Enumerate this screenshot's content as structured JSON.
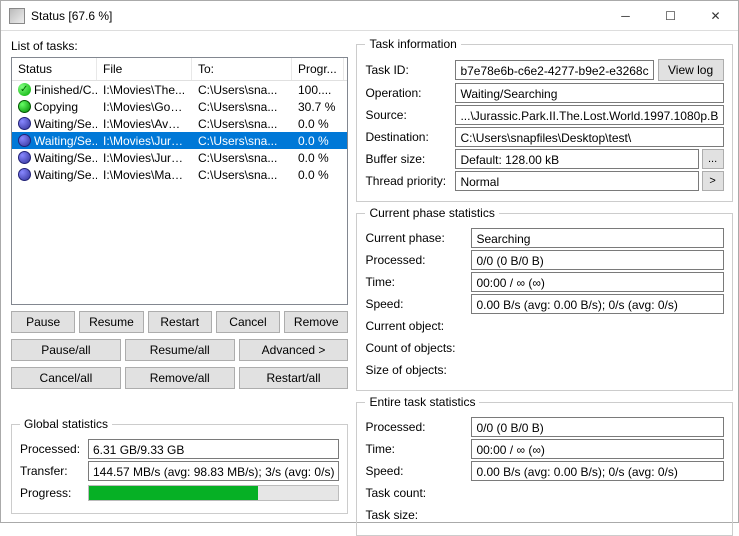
{
  "window": {
    "title": "Status [67.6 %]"
  },
  "left": {
    "listLabel": "List of tasks:",
    "columns": {
      "status": "Status",
      "file": "File",
      "to": "To:",
      "prog": "Progr..."
    },
    "rows": [
      {
        "icon": "fin",
        "status": "Finished/C...",
        "file": "I:\\Movies\\The...",
        "to": "C:\\Users\\sna...",
        "prog": "100...."
      },
      {
        "icon": "copy",
        "status": "Copying",
        "file": "I:\\Movies\\Goos...",
        "to": "C:\\Users\\sna...",
        "prog": "30.7 %"
      },
      {
        "icon": "wait",
        "status": "Waiting/Se...",
        "file": "I:\\Movies\\Aven...",
        "to": "C:\\Users\\sna...",
        "prog": "0.0 %"
      },
      {
        "icon": "wait",
        "status": "Waiting/Se...",
        "file": "I:\\Movies\\Juras...",
        "to": "C:\\Users\\sna...",
        "prog": "0.0 %",
        "sel": true
      },
      {
        "icon": "wait",
        "status": "Waiting/Se...",
        "file": "I:\\Movies\\Juras...",
        "to": "C:\\Users\\sna...",
        "prog": "0.0 %"
      },
      {
        "icon": "wait",
        "status": "Waiting/Se...",
        "file": "I:\\Movies\\Mad ...",
        "to": "C:\\Users\\sna...",
        "prog": "0.0 %"
      }
    ],
    "buttons": {
      "pause": "Pause",
      "resume": "Resume",
      "restart": "Restart",
      "cancel": "Cancel",
      "remove": "Remove",
      "pauseAll": "Pause/all",
      "resumeAll": "Resume/all",
      "advanced": "Advanced >",
      "cancelAll": "Cancel/all",
      "removeAll": "Remove/all",
      "restartAll": "Restart/all"
    },
    "global": {
      "legend": "Global statistics",
      "processedLabel": "Processed:",
      "processed": "6.31 GB/9.33 GB",
      "transferLabel": "Transfer:",
      "transfer": "144.57 MB/s (avg: 98.83 MB/s); 3/s (avg: 0/s)",
      "progressLabel": "Progress:",
      "progressPct": 67.6
    }
  },
  "task": {
    "legend": "Task information",
    "idLabel": "Task ID:",
    "id": "b7e78e6b-c6e2-4277-b9e2-e3268c",
    "viewLog": "View log",
    "opLabel": "Operation:",
    "op": "Waiting/Searching",
    "srcLabel": "Source:",
    "src": "...\\Jurassic.Park.II.The.Lost.World.1997.1080p.B",
    "dstLabel": "Destination:",
    "dst": "C:\\Users\\snapfiles\\Desktop\\test\\",
    "bufLabel": "Buffer size:",
    "buf": "Default: 128.00 kB",
    "prioLabel": "Thread priority:",
    "prio": "Normal"
  },
  "phase": {
    "legend": "Current phase statistics",
    "phaseLabel": "Current phase:",
    "phase": "Searching",
    "procLabel": "Processed:",
    "proc": "0/0 (0 B/0 B)",
    "timeLabel": "Time:",
    "time": "00:00 / ∞ (∞)",
    "speedLabel": "Speed:",
    "speed": "0.00 B/s (avg: 0.00 B/s); 0/s (avg: 0/s)",
    "curObjLabel": "Current object:",
    "curObj": "",
    "countLabel": "Count of objects:",
    "count": "",
    "sizeLabel": "Size of objects:",
    "size": ""
  },
  "entire": {
    "legend": "Entire task statistics",
    "procLabel": "Processed:",
    "proc": "0/0 (0 B/0 B)",
    "timeLabel": "Time:",
    "time": "00:00 / ∞ (∞)",
    "speedLabel": "Speed:",
    "speed": "0.00 B/s (avg: 0.00 B/s); 0/s (avg: 0/s)",
    "tcountLabel": "Task count:",
    "tcount": "",
    "tsizeLabel": "Task size:",
    "tsize": ""
  }
}
